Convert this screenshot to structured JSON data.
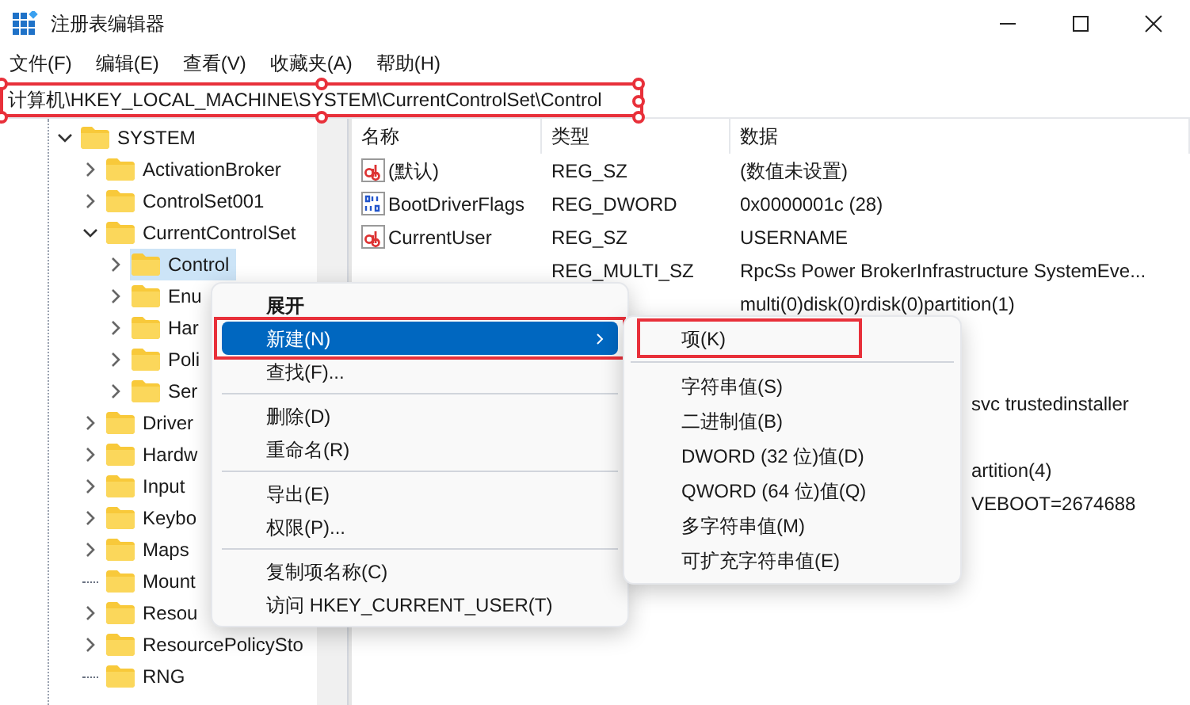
{
  "window": {
    "title": "注册表编辑器"
  },
  "menu": [
    "文件(F)",
    "编辑(E)",
    "查看(V)",
    "收藏夹(A)",
    "帮助(H)"
  ],
  "address": {
    "value": "计算机\\HKEY_LOCAL_MACHINE\\SYSTEM\\CurrentControlSet\\Control",
    "highlighted": true
  },
  "tree": [
    {
      "label": "SYSTEM",
      "has_children": true,
      "expanded": true,
      "selected": false,
      "children": [
        {
          "label": "ActivationBroker",
          "has_children": true,
          "expanded": false,
          "selected": false
        },
        {
          "label": "ControlSet001",
          "has_children": true,
          "expanded": false,
          "selected": false
        },
        {
          "label": "CurrentControlSet",
          "has_children": true,
          "expanded": true,
          "selected": false,
          "children": [
            {
              "label": "Control",
              "has_children": true,
              "expanded": false,
              "selected": true
            },
            {
              "label": "Enu",
              "has_children": true,
              "expanded": false,
              "selected": false
            },
            {
              "label": "Har",
              "has_children": true,
              "expanded": false,
              "selected": false
            },
            {
              "label": "Poli",
              "has_children": true,
              "expanded": false,
              "selected": false
            },
            {
              "label": "Ser",
              "has_children": true,
              "expanded": false,
              "selected": false
            }
          ]
        },
        {
          "label": "Driver",
          "has_children": true,
          "expanded": false,
          "selected": false
        },
        {
          "label": "Hardw",
          "has_children": true,
          "expanded": false,
          "selected": false
        },
        {
          "label": "Input",
          "has_children": true,
          "expanded": false,
          "selected": false
        },
        {
          "label": "Keybo",
          "has_children": true,
          "expanded": false,
          "selected": false
        },
        {
          "label": "Maps",
          "has_children": true,
          "expanded": false,
          "selected": false
        },
        {
          "label": "Mount",
          "has_children": false,
          "expanded": false,
          "selected": false
        },
        {
          "label": "Resou",
          "has_children": true,
          "expanded": false,
          "selected": false
        },
        {
          "label": "ResourcePolicySto",
          "has_children": true,
          "expanded": false,
          "selected": false
        },
        {
          "label": "RNG",
          "has_children": false,
          "expanded": false,
          "selected": false
        }
      ]
    }
  ],
  "table": {
    "columns": [
      "名称",
      "类型",
      "数据"
    ],
    "rows": [
      {
        "kind": "string",
        "name": "(默认)",
        "type": "REG_SZ",
        "data": "(数值未设置)"
      },
      {
        "kind": "binary",
        "name": "BootDriverFlags",
        "type": "REG_DWORD",
        "data": "0x0000001c (28)"
      },
      {
        "kind": "string",
        "name": "CurrentUser",
        "type": "REG_SZ",
        "data": "USERNAME"
      },
      {
        "kind": "covered",
        "type": "REG_MULTI_SZ",
        "data": "RpcSs Power BrokerInfrastructure SystemEve..."
      },
      {
        "kind": "covered",
        "data": "multi(0)disk(0)rdisk(0)partition(1)"
      },
      {
        "kind": "fragment",
        "data": "svc trustedinstaller"
      },
      {
        "kind": "fragment",
        "data": "artition(4)"
      },
      {
        "kind": "fragment",
        "data": "VEBOOT=2674688"
      }
    ]
  },
  "context_menu": {
    "groups": [
      [
        {
          "label": "展开",
          "bold": true,
          "selected": false,
          "submenu": false,
          "highlighted": false
        },
        {
          "label": "新建(N)",
          "bold": false,
          "selected": true,
          "submenu": true,
          "highlighted": true
        },
        {
          "label": "查找(F)...",
          "bold": false,
          "selected": false,
          "submenu": false,
          "highlighted": false
        }
      ],
      [
        {
          "label": "删除(D)",
          "bold": false,
          "selected": false,
          "submenu": false,
          "highlighted": false
        },
        {
          "label": "重命名(R)",
          "bold": false,
          "selected": false,
          "submenu": false,
          "highlighted": false
        }
      ],
      [
        {
          "label": "导出(E)",
          "bold": false,
          "selected": false,
          "submenu": false,
          "highlighted": false
        },
        {
          "label": "权限(P)...",
          "bold": false,
          "selected": false,
          "submenu": false,
          "highlighted": false
        }
      ],
      [
        {
          "label": "复制项名称(C)",
          "bold": false,
          "selected": false,
          "submenu": false,
          "highlighted": false
        },
        {
          "label": "访问 HKEY_CURRENT_USER(T)",
          "bold": false,
          "selected": false,
          "submenu": false,
          "highlighted": false
        }
      ]
    ]
  },
  "submenu": {
    "groups": [
      [
        {
          "label": "项(K)",
          "highlighted": true
        }
      ],
      [
        {
          "label": "字符串值(S)",
          "highlighted": false
        },
        {
          "label": "二进制值(B)",
          "highlighted": false
        },
        {
          "label": "DWORD (32 位)值(D)",
          "highlighted": false
        },
        {
          "label": "QWORD (64 位)值(Q)",
          "highlighted": false
        },
        {
          "label": "多字符串值(M)",
          "highlighted": false
        },
        {
          "label": "可扩充字符串值(E)",
          "highlighted": false
        }
      ]
    ]
  }
}
